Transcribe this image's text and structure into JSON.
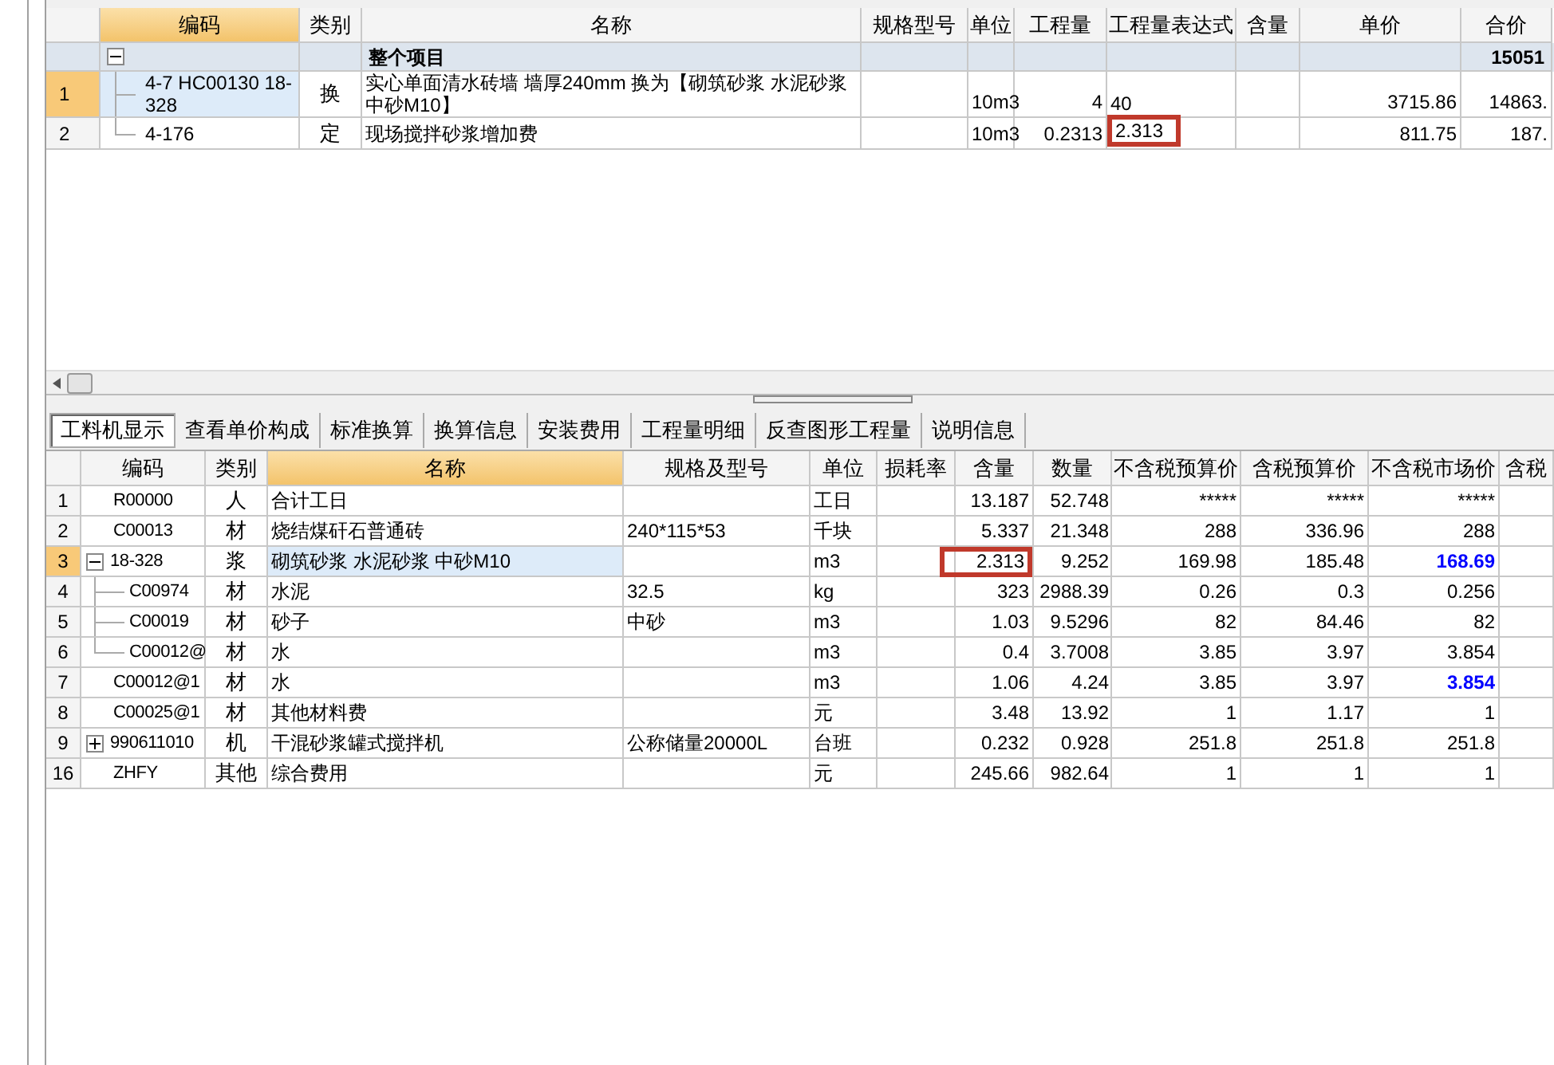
{
  "top_table": {
    "columns": [
      {
        "selected": false
      },
      {
        "label": "编码",
        "selected": true
      },
      {
        "label": "类别",
        "selected": false
      },
      {
        "label": "名称",
        "selected": false
      },
      {
        "label": "规格型号",
        "selected": false
      },
      {
        "label": "单位",
        "selected": false
      },
      {
        "label": "工程量",
        "selected": false
      },
      {
        "label": "工程量表达式",
        "selected": false
      },
      {
        "label": "含量",
        "selected": false
      },
      {
        "label": "单价",
        "selected": false
      },
      {
        "label": "合价",
        "selected": false
      }
    ],
    "groups": [
      {
        "name": "整个项目",
        "total": "15051",
        "expanded": true,
        "children": [
          {
            "num": "1",
            "code": "4-7 HC00130 18-328",
            "type": "换",
            "name": "实心单面清水砖墙 墙厚240mm 换为【砌筑砂浆 水泥砂浆中砂M10】",
            "unit": "10m3",
            "qty": "4",
            "expr": "40",
            "price": "3715.86",
            "total": "14863.",
            "selected": true,
            "expr_highlighted": false
          },
          {
            "num": "2",
            "code": "4-176",
            "type": "定",
            "name": "现场搅拌砂浆增加费",
            "unit": "10m3",
            "qty": "0.2313",
            "expr": "2.313",
            "price": "811.75",
            "total": "187.",
            "selected": false,
            "expr_highlighted": true
          }
        ]
      }
    ]
  },
  "tabs": [
    {
      "label": "工料机显示",
      "selected": true
    },
    {
      "label": "查看单价构成",
      "selected": false
    },
    {
      "label": "标准换算",
      "selected": false
    },
    {
      "label": "换算信息",
      "selected": false
    },
    {
      "label": "安装费用",
      "selected": false
    },
    {
      "label": "工程量明细",
      "selected": false
    },
    {
      "label": "反查图形工程量",
      "selected": false
    },
    {
      "label": "说明信息",
      "selected": false
    }
  ],
  "bottom_table": {
    "columns": [
      {
        "selected": false
      },
      {
        "label": "编码",
        "selected": false
      },
      {
        "label": "类别",
        "selected": false
      },
      {
        "label": "名称",
        "selected": true
      },
      {
        "label": "规格及型号",
        "selected": false
      },
      {
        "label": "单位",
        "selected": false
      },
      {
        "label": "损耗率",
        "selected": false
      },
      {
        "label": "含量",
        "selected": false
      },
      {
        "label": "数量",
        "selected": false
      },
      {
        "label": "不含税预算价",
        "selected": false
      },
      {
        "label": "含税预算价",
        "selected": false
      },
      {
        "label": "不含税市场价",
        "selected": false
      },
      {
        "label": "含税",
        "selected": false
      }
    ],
    "rows": [
      {
        "num": "1",
        "code": "R00000",
        "type": "人",
        "name": "合计工日",
        "unit": "工日",
        "content": "13.187",
        "qty": "52.748",
        "p1": "*****",
        "p2": "*****",
        "p3": "*****",
        "selected": false,
        "emphasized": false,
        "content_highlighted": false
      },
      {
        "num": "2",
        "code": "C00013",
        "type": "材",
        "name": "烧结煤矸石普通砖",
        "spec": "240*115*53",
        "unit": "千块",
        "content": "5.337",
        "qty": "21.348",
        "p1": "288",
        "p2": "336.96",
        "p3": "288",
        "selected": false,
        "emphasized": false,
        "content_highlighted": false
      },
      {
        "num": "3",
        "code": "18-328",
        "type": "浆",
        "name": "砌筑砂浆 水泥砂浆 中砂M10",
        "unit": "m3",
        "content": "2.313",
        "qty": "9.252",
        "p1": "169.98",
        "p2": "185.48",
        "p3": "168.69",
        "selected": true,
        "emphasized": true,
        "content_highlighted": true,
        "expanded": true,
        "children": [
          {
            "num": "4",
            "code": "C00974",
            "type": "材",
            "name": "水泥",
            "spec": "32.5",
            "unit": "kg",
            "content": "323",
            "qty": "2988.39",
            "p1": "0.26",
            "p2": "0.3",
            "p3": "0.256",
            "selected": false,
            "emphasized": false,
            "content_highlighted": false
          },
          {
            "num": "5",
            "code": "C00019",
            "type": "材",
            "name": "砂子",
            "spec": "中砂",
            "unit": "m3",
            "content": "1.03",
            "qty": "9.5296",
            "p1": "82",
            "p2": "84.46",
            "p3": "82",
            "selected": false,
            "emphasized": false,
            "content_highlighted": false
          },
          {
            "num": "6",
            "code": "C00012@",
            "type": "材",
            "name": "水",
            "unit": "m3",
            "content": "0.4",
            "qty": "3.7008",
            "p1": "3.85",
            "p2": "3.97",
            "p3": "3.854",
            "selected": false,
            "emphasized": false,
            "content_highlighted": false
          }
        ]
      },
      {
        "num": "7",
        "code": "C00012@1",
        "type": "材",
        "name": "水",
        "unit": "m3",
        "content": "1.06",
        "qty": "4.24",
        "p1": "3.85",
        "p2": "3.97",
        "p3": "3.854",
        "selected": false,
        "emphasized": true,
        "content_highlighted": false
      },
      {
        "num": "8",
        "code": "C00025@1",
        "type": "材",
        "name": "其他材料费",
        "unit": "元",
        "content": "3.48",
        "qty": "13.92",
        "p1": "1",
        "p2": "1.17",
        "p3": "1",
        "selected": false,
        "emphasized": false,
        "content_highlighted": false
      },
      {
        "num": "9",
        "code": "990611010",
        "type": "机",
        "name": "干混砂浆罐式搅拌机",
        "spec": "公称储量20000L",
        "unit": "台班",
        "content": "0.232",
        "qty": "0.928",
        "p1": "251.8",
        "p2": "251.8",
        "p3": "251.8",
        "selected": false,
        "emphasized": false,
        "content_highlighted": false,
        "expanded": false
      },
      {
        "num": "16",
        "code": "ZHFY",
        "type": "其他",
        "name": "综合费用",
        "unit": "元",
        "content": "245.66",
        "qty": "982.64",
        "p1": "1",
        "p2": "1",
        "p3": "1",
        "selected": false,
        "emphasized": false,
        "content_highlighted": false
      }
    ]
  }
}
